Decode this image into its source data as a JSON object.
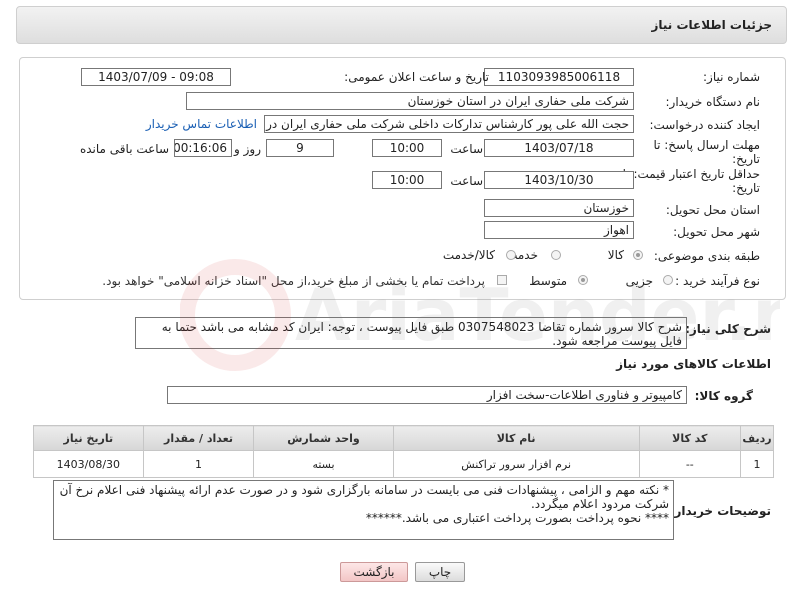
{
  "header": {
    "title": "جزئیات اطلاعات نیاز"
  },
  "form": {
    "need_number_label": "شماره نیاز:",
    "need_number": "1103093985006118",
    "announce_label": "تاریخ و ساعت اعلان عمومی:",
    "announce_value": "1403/07/09 - 09:08",
    "buyer_org_label": "نام دستگاه خریدار:",
    "buyer_org": "شرکت ملی حفاری ایران در استان خوزستان",
    "creator_label": "ایجاد کننده درخواست:",
    "creator": "حجت الله علی پور کارشناس تدارکات داخلی شرکت ملی حفاری ایران در استان",
    "contact_link": "اطلاعات تماس خریدار",
    "deadline_label_1": "مهلت ارسال پاسخ: تا",
    "deadline_label_2": "تاریخ:",
    "deadline_date": "1403/07/18",
    "time_label": "ساعت",
    "deadline_time": "10:00",
    "days_value": "9",
    "days_label": "روز و",
    "remaining_value": "00:16:06",
    "remaining_label": "ساعت باقی مانده",
    "validity_label_1": "حداقل تاریخ اعتبار قیمت: تا",
    "validity_label_2": "تاریخ:",
    "validity_date": "1403/10/30",
    "validity_time": "10:00",
    "province_label": "استان محل تحویل:",
    "province": "خوزستان",
    "city_label": "شهر محل تحویل:",
    "city": "اهواز",
    "category_label": "طبقه بندی موضوعی:",
    "category_options": [
      "کالا",
      "خدمت",
      "کالا/خدمت"
    ],
    "category_selected": "کالا",
    "process_label": "نوع فرآیند خرید :",
    "process_options": [
      "جزیی",
      "متوسط"
    ],
    "process_selected": "متوسط",
    "payment_note": "پرداخت تمام یا بخشی از مبلغ خرید،از محل \"اسناد خزانه اسلامی\" خواهد بود."
  },
  "description": {
    "label": "شرح کلی نیاز:",
    "text": "شرح کالا  سرور  شماره تقاضا  0307548023  طبق فایل پیوست ، توجه: ایران کد مشابه می باشد حتما به فایل پیوست مراجعه شود."
  },
  "goods_section": {
    "title": "اطلاعات کالاهای مورد نیاز",
    "group_label": "گروه کالا:",
    "group_value": "کامپیوتر و فناوری اطلاعات-سخت افزار"
  },
  "table": {
    "headers": [
      "ردیف",
      "کد کالا",
      "نام کالا",
      "واحد شمارش",
      "تعداد / مقدار",
      "تاریخ نیاز"
    ],
    "rows": [
      [
        "1",
        "--",
        "نرم افزار سرور تراکنش",
        "بسته",
        "1",
        "1403/08/30"
      ]
    ]
  },
  "buyer_notes": {
    "label": "توضیحات خریدار:",
    "line1": "*  نکته مهم و الزامی ، پیشنهادات فنی می بایست در سامانه بارگزاری شود و در صورت عدم ارائه پیشنهاد فنی اعلام نرخ آن شرکت مردود اعلام میگردد.",
    "line2": "****    نحوه پرداخت بصورت پرداخت اعتباری می باشد.******"
  },
  "buttons": {
    "print": "چاپ",
    "back": "بازگشت"
  },
  "watermark": {
    "text": "AriaTender.neT"
  },
  "colors": {
    "link": "#1a5fb4",
    "back_button": "#f3c6c6",
    "watermark": "#d32f2f"
  }
}
